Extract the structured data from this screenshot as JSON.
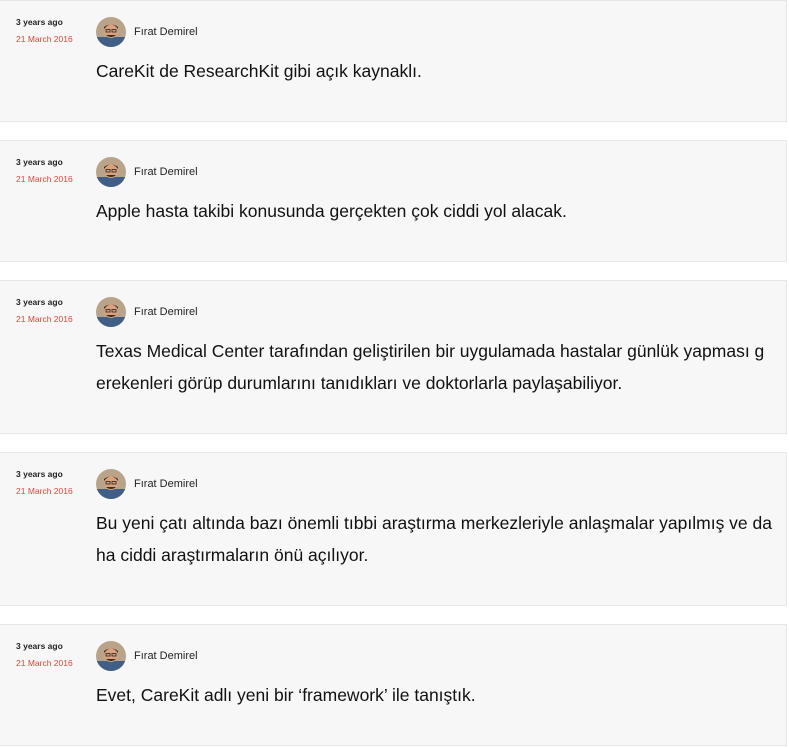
{
  "posts": [
    {
      "time_ago": "3 years ago",
      "date": "21 March 2016",
      "author": "Fırat Demirel",
      "text": "CareKit de ResearchKit gibi açık kaynaklı."
    },
    {
      "time_ago": "3 years ago",
      "date": "21 March 2016",
      "author": "Fırat Demirel",
      "text": "Apple hasta takibi konusunda gerçekten çok ciddi yol alacak."
    },
    {
      "time_ago": "3 years ago",
      "date": "21 March 2016",
      "author": "Fırat Demirel",
      "text": "Texas Medical Center tarafından geliştirilen bir uygulamada hastalar günlük yapması gerekenleri görüp durumlarını tanıdıkları ve doktorlarla paylaşabiliyor."
    },
    {
      "time_ago": "3 years ago",
      "date": "21 March 2016",
      "author": "Fırat Demirel",
      "text": "Bu yeni çatı altında bazı önemli tıbbi araştırma merkezleriyle anlaşmalar yapılmış ve daha ciddi araştırmaların önü açılıyor."
    },
    {
      "time_ago": "3 years ago",
      "date": "21 March 2016",
      "author": "Fırat Demirel",
      "text": "Evet, CareKit adlı yeni bir ‘framework’ ile tanıştık."
    }
  ],
  "colors": {
    "card_background": "#f7f7f7",
    "date_red": "#d9473b",
    "text": "#111111"
  },
  "icons": {
    "avatar": "user-avatar-photo"
  }
}
